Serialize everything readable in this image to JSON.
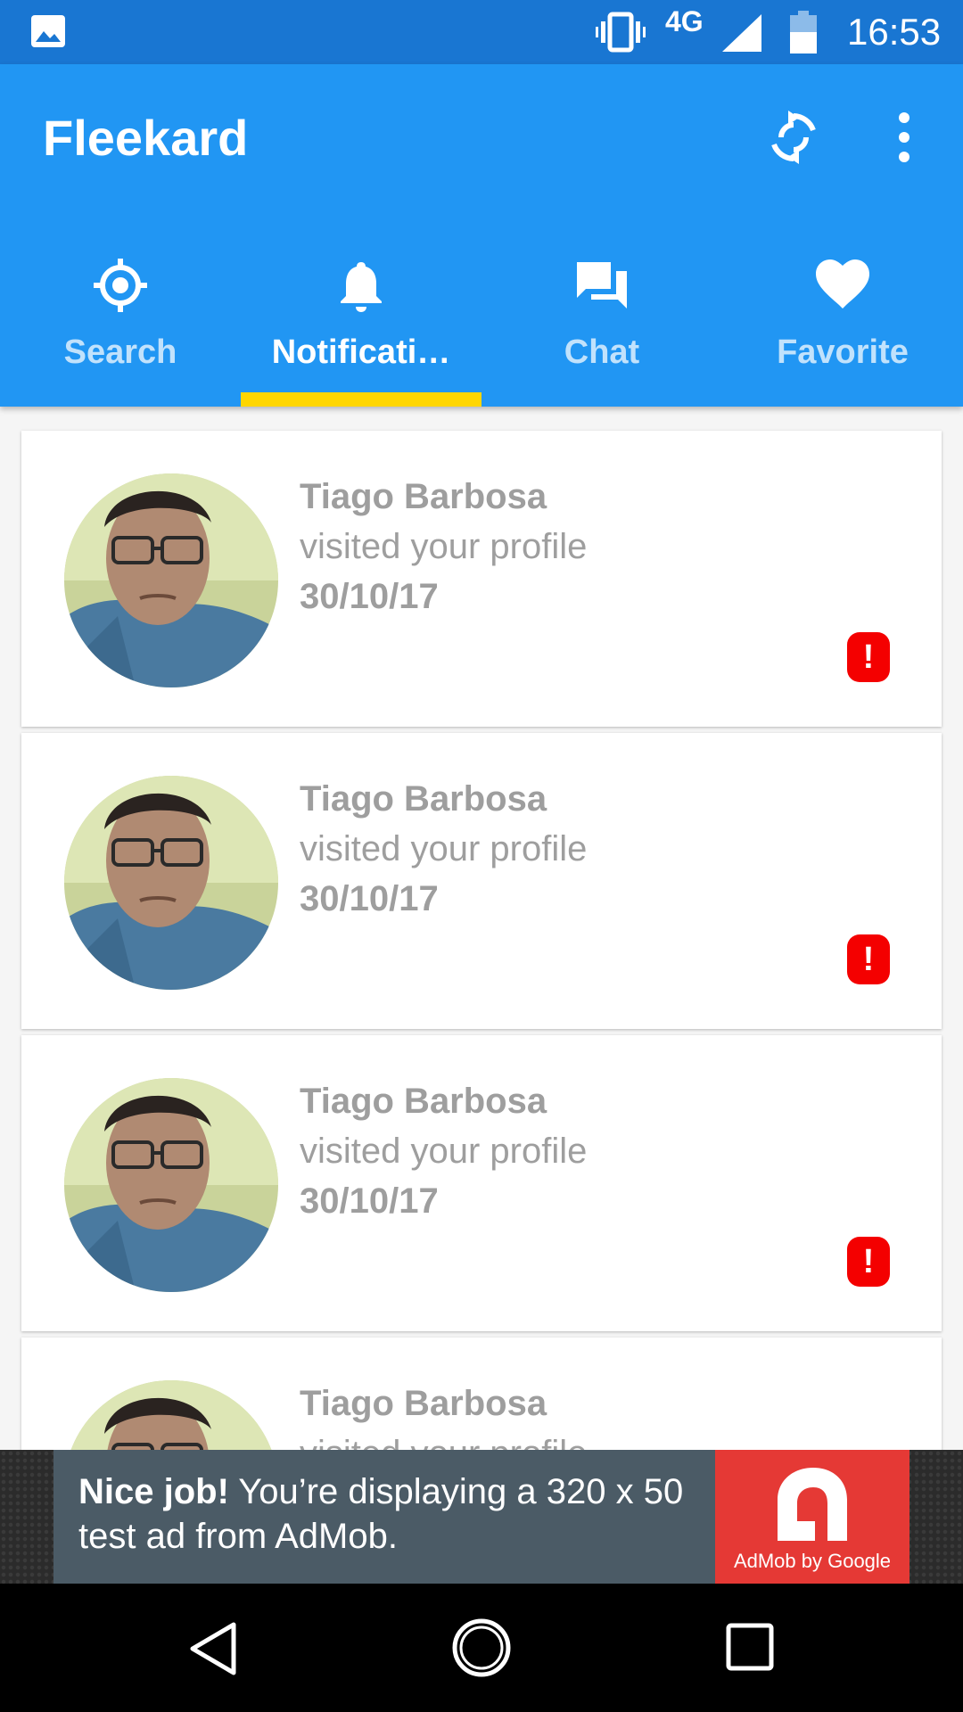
{
  "status_bar": {
    "network": "4G",
    "time": "16:53"
  },
  "app_bar": {
    "title": "Fleekard"
  },
  "tabs": [
    {
      "label": "Search",
      "icon": "target-icon",
      "active": false
    },
    {
      "label": "Notificati…",
      "icon": "bell-icon",
      "active": true
    },
    {
      "label": "Chat",
      "icon": "chat-icon",
      "active": false
    },
    {
      "label": "Favorite",
      "icon": "heart-icon",
      "active": false
    }
  ],
  "notifications": [
    {
      "name": "Tiago Barbosa",
      "action": "visited your profile",
      "date": "30/10/17",
      "badge": "!"
    },
    {
      "name": "Tiago Barbosa",
      "action": "visited your profile",
      "date": "30/10/17",
      "badge": "!"
    },
    {
      "name": "Tiago Barbosa",
      "action": "visited your profile",
      "date": "30/10/17",
      "badge": "!"
    },
    {
      "name": "Tiago Barbosa",
      "action": "visited your profile",
      "date": "",
      "badge": ""
    }
  ],
  "ad": {
    "headline": "Nice job!",
    "body": "You’re displaying a 320 x 50 test ad from AdMob.",
    "brand": "AdMob by Google"
  },
  "colors": {
    "primary": "#2196f3",
    "primary_dark": "#1976d2",
    "indicator": "#ffd600",
    "alert": "#f40000"
  }
}
